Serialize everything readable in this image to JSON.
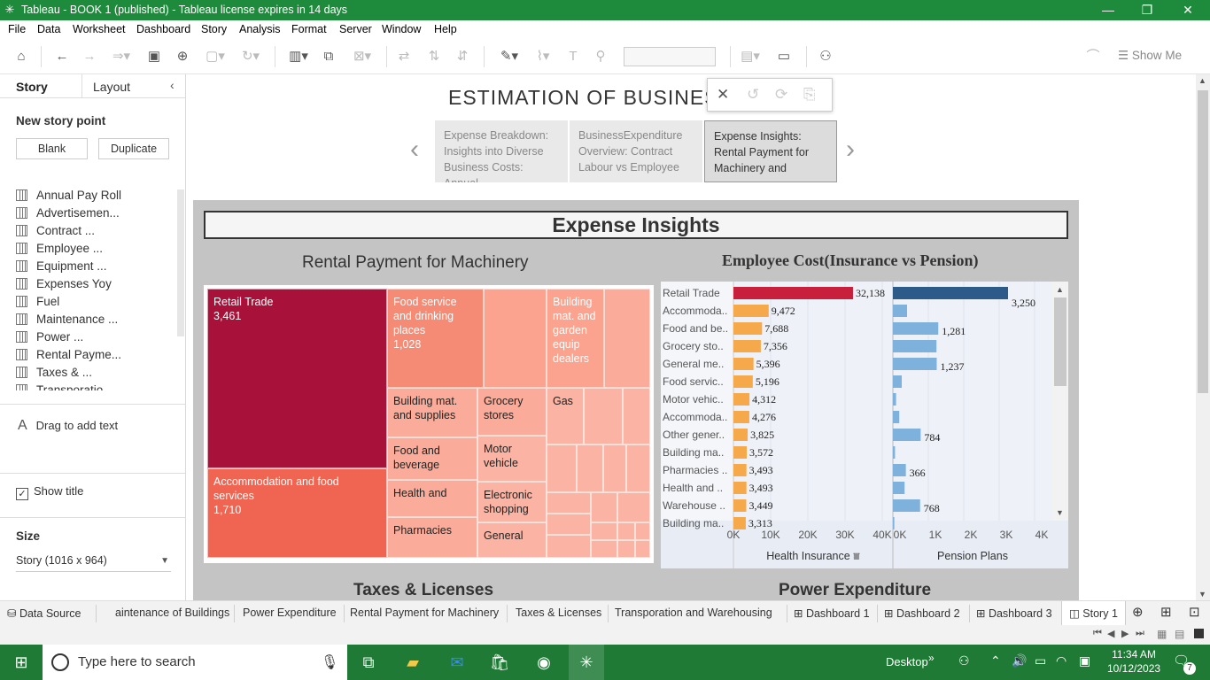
{
  "window": {
    "title": "Tableau - BOOK 1 (published) - Tableau license expires in 14 days",
    "minimize": "—",
    "restore": "❐",
    "close": "✕"
  },
  "menu": [
    "File",
    "Data",
    "Worksheet",
    "Dashboard",
    "Story",
    "Analysis",
    "Format",
    "Server",
    "Window",
    "Help"
  ],
  "toolbar": {
    "show_me": "Show Me"
  },
  "left": {
    "tab_story": "Story",
    "tab_layout": "Layout",
    "new_story_point": "New story point",
    "blank": "Blank",
    "duplicate": "Duplicate",
    "sheets": [
      "Annual Pay Roll",
      "Advertisemen...",
      "Contract ...",
      "Employee ...",
      "Equipment ...",
      "Expenses Yoy",
      "Fuel",
      "Maintenance ...",
      "Power ...",
      "Rental Payme...",
      "Taxes & ...",
      "Transporatio..."
    ],
    "drag_text": "Drag to add text",
    "show_title": "Show title",
    "show_title_checked": true,
    "size_label": "Size",
    "size_value": "Story (1016 x 964)"
  },
  "story": {
    "title": "ESTIMATION OF BUSINESS",
    "points": [
      {
        "text": "Expense Breakdown: Insights into Diverse Business Costs: Annual",
        "active": false
      },
      {
        "text": "BusinessExpenditure Overview: Contract Labour vs Employee",
        "active": false
      },
      {
        "text": "Expense Insights: Rental Payment for Machinery and",
        "active": true
      }
    ]
  },
  "dashboard": {
    "title": "Expense Insights",
    "rental_title": "Rental Payment for Machinery",
    "employee_title": "Employee Cost(Insurance vs Pension)",
    "taxes_title": "Taxes & Licenses",
    "power_title": "Power Expenditure"
  },
  "treemap": {
    "cells": [
      {
        "label": "Retail Trade",
        "value": "3,461",
        "color": "#a8123a"
      },
      {
        "label": "Accommodation and food services",
        "value": "1,710",
        "color": "#f06452"
      },
      {
        "label": "Food service and drinking places",
        "value": "1,028",
        "color": "#f58a75"
      },
      {
        "label": "Building mat. and garden equip dealers",
        "value": "",
        "color": "#fbab99"
      },
      {
        "label": "Building mat. and supplies",
        "value": "",
        "color": "#fbab99"
      },
      {
        "label": "Grocery stores",
        "value": "",
        "color": "#fbab99"
      },
      {
        "label": "Gas",
        "value": "",
        "color": "#fbb3a3"
      },
      {
        "label": "Food and beverage",
        "value": "",
        "color": "#fbab99"
      },
      {
        "label": "Motor vehicle",
        "value": "",
        "color": "#fbb3a3"
      },
      {
        "label": "Health and",
        "value": "",
        "color": "#fbab99"
      },
      {
        "label": "Electronic shopping",
        "value": "",
        "color": "#fbb3a3"
      },
      {
        "label": "Pharmacies",
        "value": "",
        "color": "#fbab99"
      },
      {
        "label": "General",
        "value": "",
        "color": "#fbb3a3"
      }
    ]
  },
  "chart_data": {
    "type": "bar",
    "categories": [
      "Retail Trade",
      "Accommoda..",
      "Food and be..",
      "Grocery sto..",
      "General me..",
      "Food servic..",
      "Motor vehic..",
      "Accommoda..",
      "Other gener..",
      "Building ma..",
      "Pharmacies ..",
      "Health and ..",
      "Warehouse ..",
      "Building ma.."
    ],
    "series": [
      {
        "name": "Health Insurance",
        "values": [
          32138,
          9472,
          7688,
          7356,
          5396,
          5196,
          4312,
          4276,
          3825,
          3572,
          3493,
          3493,
          3449,
          3313
        ],
        "labels": [
          "32,138",
          "9,472",
          "7,688",
          "7,356",
          "5,396",
          "5,196",
          "4,312",
          "4,276",
          "3,825",
          "3,572",
          "3,493",
          "3,493",
          "3,449",
          "3,313"
        ],
        "color": "#f6a94a",
        "highlight_color": "#c8203c"
      },
      {
        "name": "Pension Plans",
        "values": [
          3250,
          400,
          1281,
          1230,
          1237,
          250,
          90,
          180,
          784,
          60,
          366,
          330,
          768,
          40
        ],
        "labels": [
          "3,250",
          "",
          "1,281",
          "",
          "1,237",
          "",
          "",
          "",
          "784",
          "",
          "366",
          "",
          "768",
          ""
        ],
        "color": "#7eb1dc",
        "highlight_color": "#2c5b8a"
      }
    ],
    "xticks_left": [
      "0K",
      "10K",
      "20K",
      "30K",
      "40K"
    ],
    "xlim_left": [
      0,
      40000
    ],
    "xticks_right": [
      "0K",
      "1K",
      "2K",
      "3K",
      "4K"
    ],
    "xlim_right": [
      0,
      4000
    ]
  },
  "sheettabs": [
    "Data Source",
    "aintenance of Buildings",
    "Power Expenditure",
    "Rental Payment for Machinery",
    "Taxes & Licenses",
    "Transporation and Warehousing",
    "Dashboard 1",
    "Dashboard 2",
    "Dashboard 3",
    "Story 1"
  ],
  "taskbar": {
    "search_placeholder": "Type here to search",
    "desktop": "Desktop",
    "time": "11:34 AM",
    "date": "10/12/2023",
    "notif": "7"
  }
}
